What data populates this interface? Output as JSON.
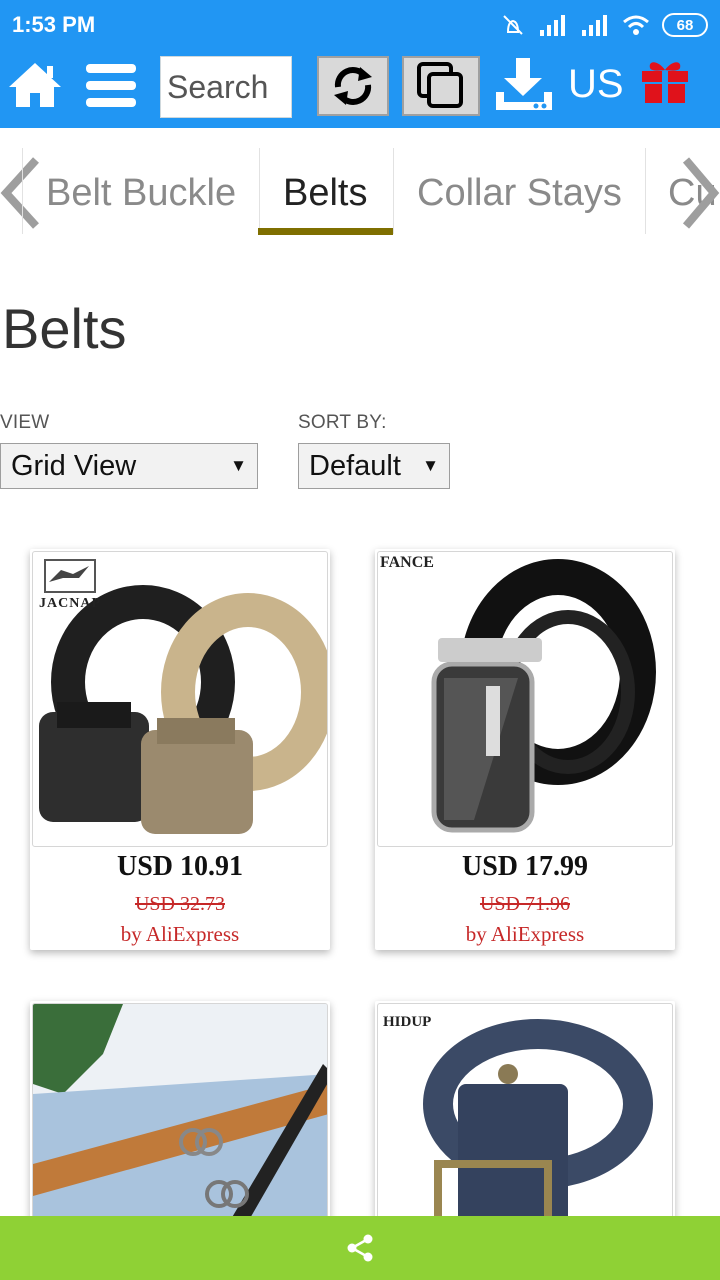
{
  "status_bar": {
    "time": "1:53 PM",
    "battery": "68"
  },
  "toolbar": {
    "search_placeholder": "Search",
    "region": "US"
  },
  "categories": {
    "tabs": [
      "Belt Buckle",
      "Belts",
      "Collar Stays",
      "Cu"
    ],
    "active": "Belts"
  },
  "page": {
    "title": "Belts"
  },
  "controls": {
    "view_label": "VIEW",
    "view_value": "Grid View",
    "sort_label": "SORT BY:",
    "sort_value": "Default"
  },
  "products": [
    {
      "brand": "JACNAP",
      "price": "USD 10.91",
      "old_price": "USD 32.73",
      "seller": "by AliExpress"
    },
    {
      "brand": "FANCE",
      "price": "USD 17.99",
      "old_price": "USD 71.96",
      "seller": "by AliExpress"
    },
    {
      "brand": "",
      "price": "",
      "old_price": "",
      "seller": ""
    },
    {
      "brand": "HIDUP",
      "price": "",
      "old_price": "",
      "seller": ""
    }
  ],
  "colors": {
    "topbar": "#2196f3",
    "tab_underline": "#7f6f00",
    "price_old": "#c62828",
    "share_bar": "#8fd135",
    "gift": "#e0121b"
  },
  "icons": [
    "home-icon",
    "menu-icon",
    "refresh-icon",
    "copy-icon",
    "download-icon",
    "gift-icon",
    "chevron-left-icon",
    "chevron-right-icon",
    "share-icon"
  ]
}
